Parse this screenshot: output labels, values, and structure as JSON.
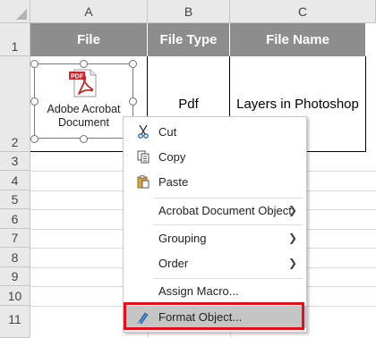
{
  "columns": [
    "A",
    "B",
    "C"
  ],
  "rows": [
    "1",
    "2",
    "3",
    "4",
    "5",
    "6",
    "7",
    "8",
    "9",
    "10",
    "11"
  ],
  "table": {
    "headers": [
      "File",
      "File Type",
      "File Name"
    ],
    "row": {
      "type": "Pdf",
      "name": "Layers in Photoshop"
    }
  },
  "embedded_object": {
    "badge": "PDF",
    "label_line1": "Adobe Acrobat",
    "label_line2": "Document"
  },
  "context_menu": {
    "items": [
      {
        "label": "Cut",
        "icon": "scissors-icon"
      },
      {
        "label": "Copy",
        "icon": "copy-icon"
      },
      {
        "label": "Paste",
        "icon": "paste-icon"
      },
      {
        "label": "Acrobat Document Object",
        "submenu": true
      },
      {
        "label": "Grouping",
        "submenu": true
      },
      {
        "label": "Order",
        "submenu": true
      },
      {
        "label": "Assign Macro..."
      },
      {
        "label": "Format Object...",
        "icon": "format-object-icon",
        "highlighted": true
      }
    ]
  },
  "colors": {
    "header_fill": "#8d8d8d",
    "highlight_border": "#e2101a",
    "pdf_red": "#c7262c"
  }
}
